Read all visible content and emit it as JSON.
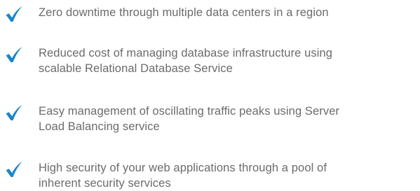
{
  "icon": "checkmark-icon",
  "accent_color": "#1a86c8",
  "text_color": "#6b6b6b",
  "features": [
    {
      "lines": [
        "Zero downtime through multiple data centers in a region"
      ]
    },
    {
      "lines": [
        "Reduced cost of managing database infrastructure using",
        "scalable Relational Database Service"
      ]
    },
    {
      "lines": [
        "Easy management of oscillating traffic peaks using Server",
        "Load Balancing service"
      ]
    },
    {
      "lines": [
        "High security of your web applications through a pool of",
        "inherent security services"
      ]
    }
  ]
}
